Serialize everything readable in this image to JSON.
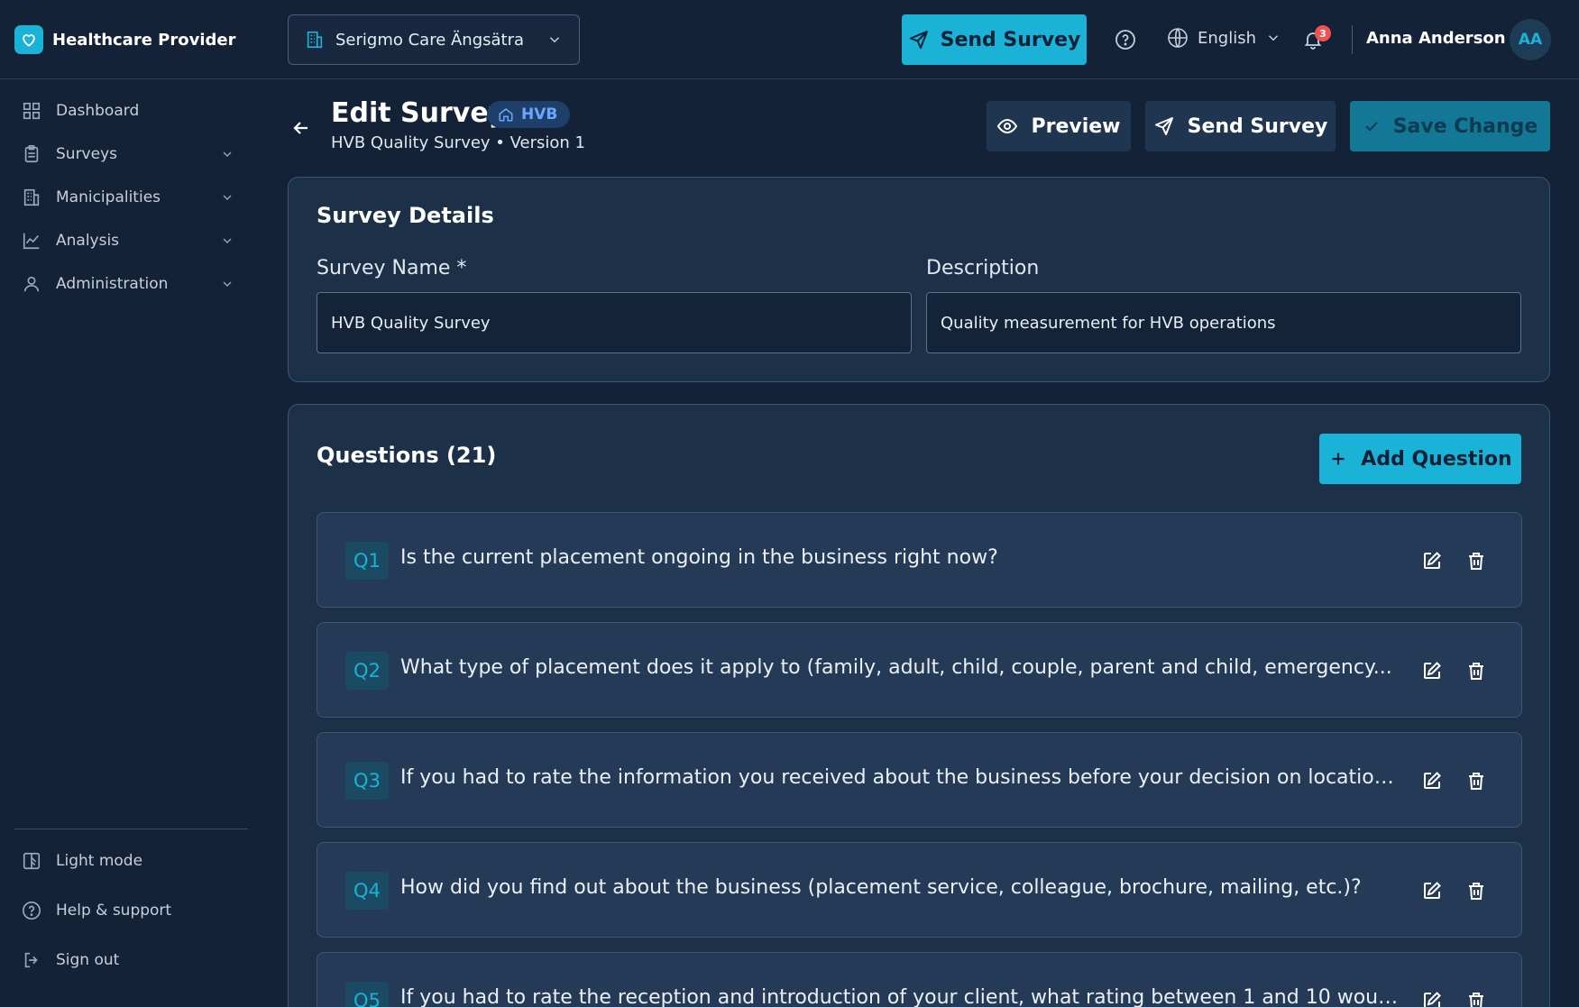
{
  "brand": {
    "name": "Healthcare Provider",
    "icon": "heart-icon",
    "color": "#1ab2d6"
  },
  "header": {
    "organization": "Serigmo Care Ängsätra",
    "send_survey": "Send Survey",
    "language": "English",
    "notification_count": "3",
    "user_name": "Anna Anderson",
    "user_initials": "AA"
  },
  "sidebar": {
    "items": [
      {
        "label": "Dashboard",
        "icon": "grid-icon",
        "expandable": false
      },
      {
        "label": "Surveys",
        "icon": "clipboard-icon",
        "expandable": true
      },
      {
        "label": "Manicipalities",
        "icon": "building-icon",
        "expandable": true
      },
      {
        "label": "Analysis",
        "icon": "chart-line-icon",
        "expandable": true
      },
      {
        "label": "Administration",
        "icon": "user-icon",
        "expandable": true
      }
    ],
    "footer": [
      {
        "label": "Light mode",
        "icon": "theme-icon"
      },
      {
        "label": "Help & support",
        "icon": "help-circle-icon"
      },
      {
        "label": "Sign out",
        "icon": "sign-out-icon"
      }
    ]
  },
  "page": {
    "title": "Edit Survey",
    "badge": "HVB",
    "subtitle": "HVB Quality Survey • Version 1",
    "actions": {
      "preview": "Preview",
      "send": "Send Survey",
      "save": "Save Change"
    }
  },
  "details": {
    "title": "Survey Details",
    "name_label": "Survey Name *",
    "name_value": "HVB Quality Survey",
    "description_label": "Description",
    "description_value": "Quality measurement for HVB operations"
  },
  "questions": {
    "title": "Questions (21)",
    "add_label": "Add Question",
    "items": [
      {
        "num": "Q1",
        "text": "Is the current placement ongoing in the business right now?"
      },
      {
        "num": "Q2",
        "text": "What type of placement does it apply to (family, adult, child, couple, parent and child, emergency..."
      },
      {
        "num": "Q3",
        "text": "If you had to rate the information you received about the business before your decision on location, ..."
      },
      {
        "num": "Q4",
        "text": "How did you find out about the business (placement service, colleague, brochure, mailing, etc.)?"
      },
      {
        "num": "Q5",
        "text": "If you had to rate the reception and introduction of your client, what rating between 1 and 10 would ..."
      }
    ]
  },
  "colors": {
    "accent": "#1ab2d6",
    "background": "#132237",
    "card": "#1c3048",
    "badge_text": "#6aa8ff",
    "notification": "#ef5350"
  }
}
